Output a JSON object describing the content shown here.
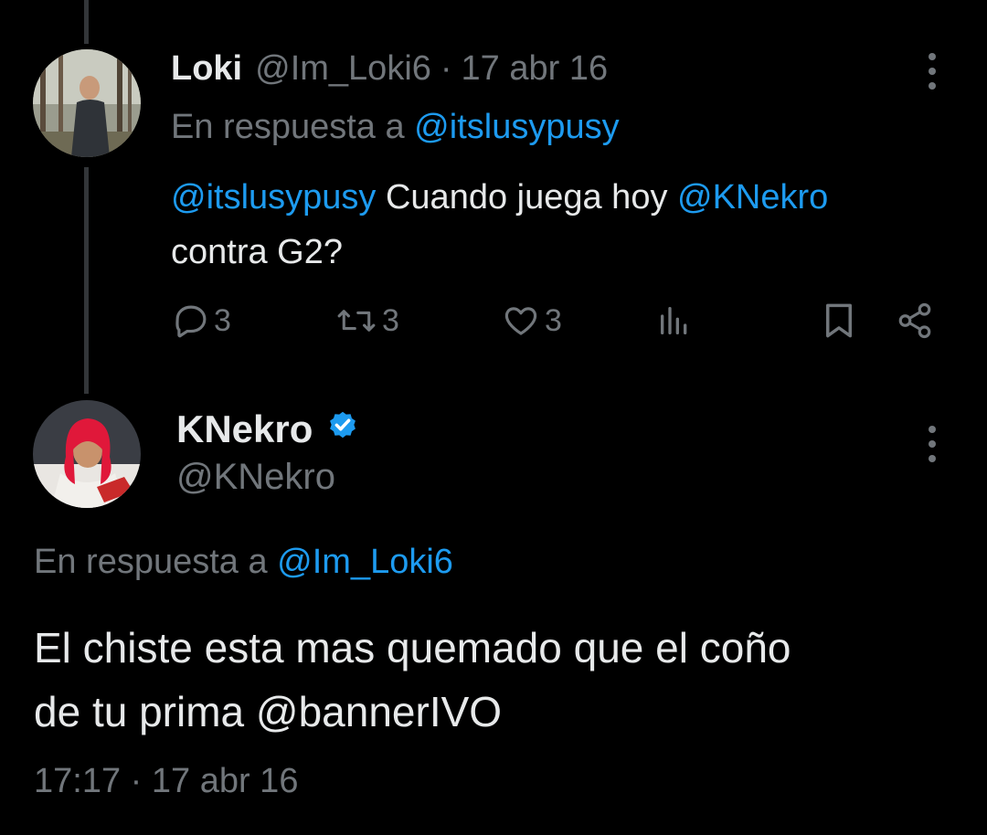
{
  "parent_tweet": {
    "author_name": "Loki",
    "author_handle": "@Im_Loki6",
    "separator": "·",
    "date": "17 abr 16",
    "reply_prefix": "En respuesta a",
    "reply_to": "@itslusypusy",
    "text_mention1": "@itslusypusy",
    "text_part1": " Cuando juega hoy ",
    "text_mention2": "@KNekro",
    "text_line2": "contra G2?",
    "replies": "3",
    "retweets": "3",
    "likes": "3"
  },
  "main_tweet": {
    "author_name": "KNekro",
    "author_handle": "@KNekro",
    "reply_prefix": "En respuesta a",
    "reply_to": "@Im_Loki6",
    "text_line1": "El chiste esta mas quemado que el coño",
    "text_line2_plain": "de tu prima ",
    "text_line2_mention": "@bannerIVO",
    "time": "17:17",
    "separator": "·",
    "date": "17 abr 16"
  },
  "colors": {
    "background": "#000000",
    "text": "#e7e9ea",
    "muted": "#71767b",
    "accent": "#1d9bf0"
  },
  "icons": [
    "reply-icon",
    "retweet-icon",
    "like-icon",
    "views-icon",
    "bookmark-icon",
    "share-icon",
    "more-icon",
    "verified-icon"
  ]
}
